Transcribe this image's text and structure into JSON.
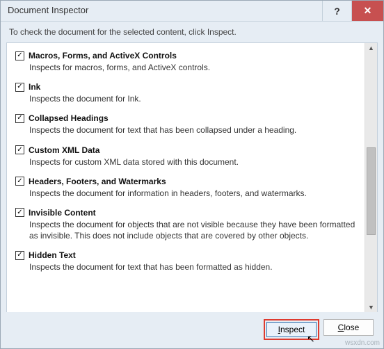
{
  "title": "Document Inspector",
  "instruction": "To check the document for the selected content, click Inspect.",
  "items": [
    {
      "label": "Macros, Forms, and ActiveX Controls",
      "desc": "Inspects for macros, forms, and ActiveX controls."
    },
    {
      "label": "Ink",
      "desc": "Inspects the document for Ink."
    },
    {
      "label": "Collapsed Headings",
      "desc": "Inspects the document for text that has been collapsed under a heading."
    },
    {
      "label": "Custom XML Data",
      "desc": "Inspects for custom XML data stored with this document."
    },
    {
      "label": "Headers, Footers, and Watermarks",
      "desc": "Inspects the document for information in headers, footers, and watermarks."
    },
    {
      "label": "Invisible Content",
      "desc": "Inspects the document for objects that are not visible because they have been formatted as invisible. This does not include objects that are covered by other objects."
    },
    {
      "label": "Hidden Text",
      "desc": "Inspects the document for text that has been formatted as hidden."
    }
  ],
  "buttons": {
    "inspect": "Inspect",
    "close": "Close",
    "close_u": "C",
    "close_rest": "lose",
    "inspect_u": "I",
    "inspect_rest": "nspect"
  },
  "watermark": "wsxdn.com"
}
